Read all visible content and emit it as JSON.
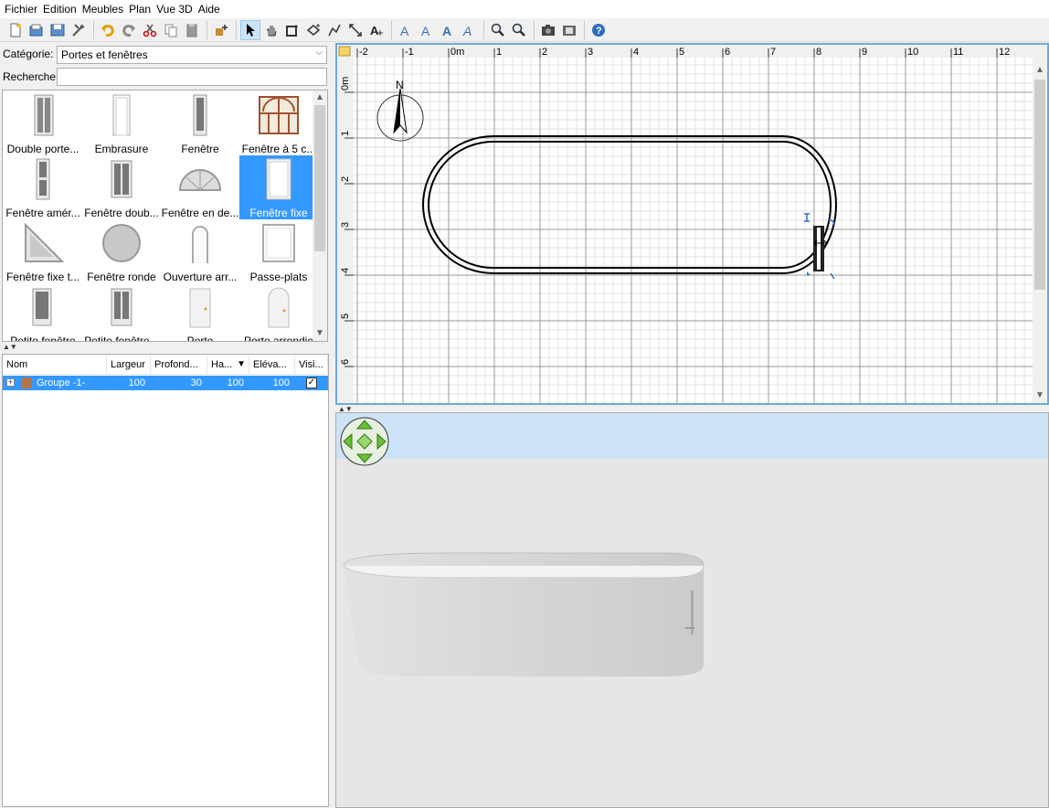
{
  "menu": [
    "Fichier",
    "Edition",
    "Meubles",
    "Plan",
    "Vue 3D",
    "Aide"
  ],
  "catalog": {
    "category_label": "Catégorie:",
    "category_value": "Portes et fenêtres",
    "search_label": "Recherche:",
    "search_value": "",
    "items": [
      {
        "label": "Double porte..."
      },
      {
        "label": "Embrasure"
      },
      {
        "label": "Fenêtre"
      },
      {
        "label": "Fenêtre à 5 c..."
      },
      {
        "label": "Fenêtre amér..."
      },
      {
        "label": "Fenêtre doub..."
      },
      {
        "label": "Fenêtre en de..."
      },
      {
        "label": "Fenêtre fixe"
      },
      {
        "label": "Fenêtre fixe t..."
      },
      {
        "label": "Fenêtre ronde"
      },
      {
        "label": "Ouverture arr..."
      },
      {
        "label": "Passe-plats"
      },
      {
        "label": "Petite fenêtre"
      },
      {
        "label": "Petite fenêtre..."
      },
      {
        "label": "Porte"
      },
      {
        "label": "Porte arrondie"
      }
    ],
    "selected_item": "Fenêtre fixe"
  },
  "furniture_table": {
    "columns": [
      "Nom",
      "Largeur",
      "Profond...",
      "Ha...",
      "Eléva...",
      "Visi..."
    ],
    "sort_indicator": "▼",
    "rows": [
      {
        "name": "Groupe -1-",
        "width": "100",
        "depth": "30",
        "height": "100",
        "elevation": "100",
        "visible": "✓"
      }
    ]
  },
  "plan": {
    "x_ticks": [
      "-2",
      "-1",
      "0m",
      "1",
      "2",
      "3",
      "4",
      "5",
      "6",
      "7",
      "8",
      "9",
      "10",
      "11",
      "12"
    ],
    "y_ticks": [
      "0m",
      "1",
      "2",
      "3",
      "4",
      "5",
      "6"
    ],
    "compass_label": "N"
  },
  "icons": {
    "toolbar": [
      "new-icon",
      "open-icon",
      "save-icon",
      "preferences-icon",
      "undo-icon",
      "redo-icon",
      "cut-icon",
      "copy-icon",
      "paste-icon",
      "add-furniture-icon",
      "select-icon",
      "pan-icon",
      "create-walls-icon",
      "create-rooms-icon",
      "create-polylines-icon",
      "create-dimensions-icon",
      "add-text-icon",
      "text-style-icon",
      "zoom-in-icon",
      "zoom-out-icon",
      "photo-icon",
      "video-icon",
      "help-icon"
    ]
  }
}
